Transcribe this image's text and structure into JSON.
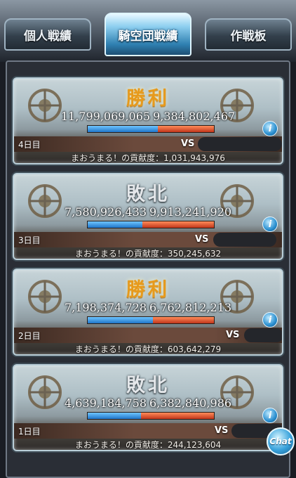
{
  "tabs": [
    "個人戦績",
    "騎空団戦績",
    "作戦板"
  ],
  "active_tab_index": 1,
  "cards": [
    {
      "result": "勝利",
      "result_type": "win",
      "our_score": "11,799,069,065",
      "their_score": "9,384,802,467",
      "blue_share": 0.557,
      "day": "4日目",
      "vs_label": "VS",
      "contribution": "まおうまる！の貢献度：1,031,943,976"
    },
    {
      "result": "敗北",
      "result_type": "lose",
      "our_score": "7,580,926,433",
      "their_score": "9,913,241,920",
      "blue_share": 0.433,
      "day": "3日目",
      "vs_label": "VS",
      "contribution": "まおうまる！の貢献度：350,245,632"
    },
    {
      "result": "勝利",
      "result_type": "win",
      "our_score": "7,198,374,728",
      "their_score": "6,762,812,213",
      "blue_share": 0.516,
      "day": "2日目",
      "vs_label": "VS",
      "contribution": "まおうまる！の貢献度：603,642,279"
    },
    {
      "result": "敗北",
      "result_type": "lose",
      "our_score": "4,639,184,758",
      "their_score": "6,382,840,986",
      "blue_share": 0.421,
      "day": "1日目",
      "vs_label": "VS",
      "contribution": "まおうまる！の貢献度：244,123,604"
    }
  ],
  "info_icon_label": "i",
  "chat_button_label": "Chat",
  "colors": {
    "win": "#e79a1c",
    "lose": "#e4e7ea",
    "bar_blue": "#1f74c8",
    "bar_red": "#c1351a"
  }
}
